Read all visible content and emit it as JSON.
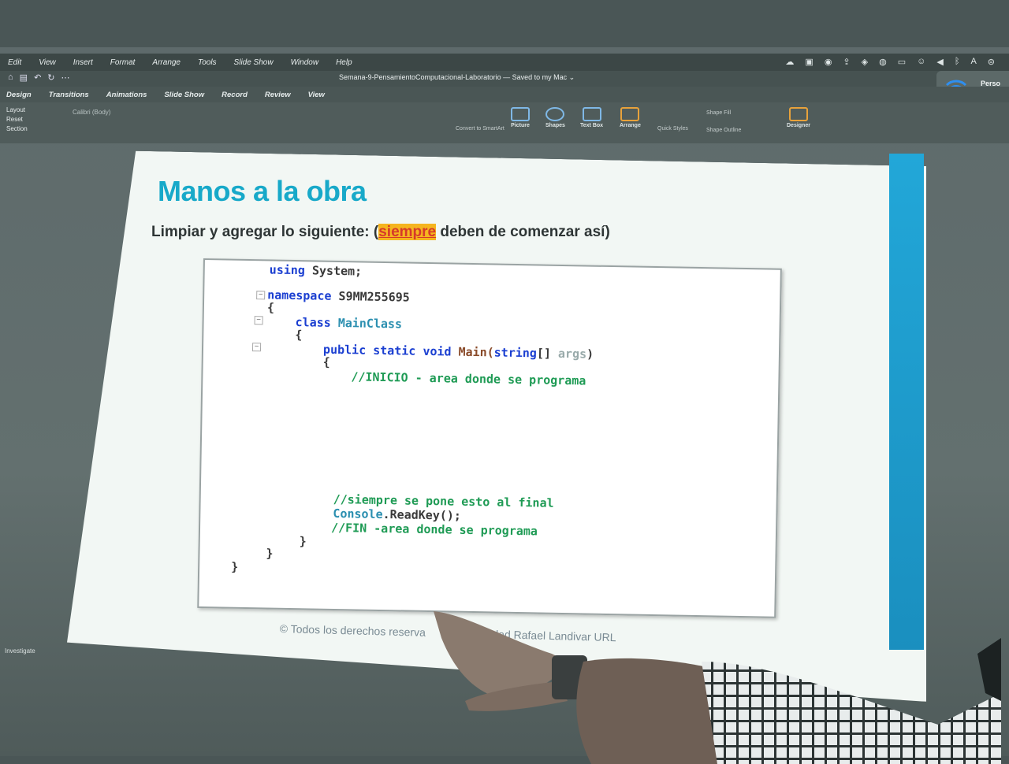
{
  "menubar": {
    "items": [
      "Edit",
      "View",
      "Insert",
      "Format",
      "Arrange",
      "Tools",
      "Slide Show",
      "Window",
      "Help"
    ]
  },
  "titlebar": {
    "doc_title": "Semana-9-PensamientoComputacional-Laboratorio — Saved to my Mac ⌄"
  },
  "ribbon_tabs": [
    "Design",
    "Transitions",
    "Animations",
    "Slide Show",
    "Record",
    "Review",
    "View"
  ],
  "ribbon": {
    "layout_label": "Layout",
    "reset_label": "Reset",
    "section_label": "Section",
    "font_name": "Calibri (Body)",
    "convert_label": "Convert to SmartArt",
    "picture_label": "Picture",
    "shapes_label": "Shapes",
    "textbox_label": "Text Box",
    "arrange_label": "Arrange",
    "quickstyles_label": "Quick Styles",
    "shapefill_label": "Shape Fill",
    "shapeoutline_label": "Shape Outline",
    "designer_label": "Designer"
  },
  "wifi_popup": {
    "text": "Perso\nDo yo"
  },
  "slide": {
    "title": "Manos a la obra",
    "subtitle_before": "Limpiar y agregar lo siguiente: (",
    "subtitle_highlight": "siempre",
    "subtitle_after": " deben de comenzar así)",
    "footer": "© Todos los derechos reserva",
    "footer_right": "ersidad Rafael Landivar URL"
  },
  "code": {
    "line1_kw": "using",
    "line1_rest": " System;",
    "line2_kw": "namespace",
    "line2_rest": " S9MM255695",
    "brace_open": "{",
    "line4_kw": "class",
    "line4_type": " MainClass",
    "line6_kw": "public static void",
    "line6_name": " Main(",
    "line6_kw2": "string",
    "line6_brk": "[] ",
    "line6_arg": "args",
    "line6_close": ")",
    "comment_inicio": "//INICIO - area donde se programa",
    "comment_siempre": "//siempre se pone esto al final",
    "console_type": "Console",
    "console_rest": ".ReadKey();",
    "comment_fin": "//FIN -area donde se programa",
    "brace_close": "}"
  },
  "status_bar": {
    "left": "Investigate"
  }
}
